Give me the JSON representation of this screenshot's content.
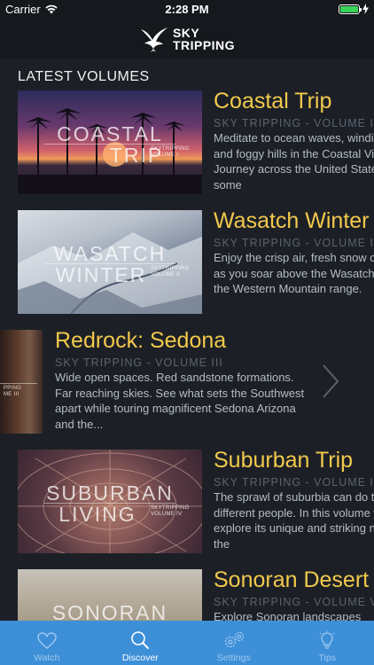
{
  "status_bar": {
    "carrier": "Carrier",
    "time": "2:28 PM",
    "battery_level": 1.0
  },
  "header": {
    "logo_line1": "SKY",
    "logo_line2": "TRIPPING"
  },
  "section_title": "LATEST VOLUMES",
  "volumes": [
    {
      "title": "Coastal Trip",
      "subtitle": "SKY TRIPPING - VOLUME I",
      "description": "Meditate to ocean waves, winding roads, and foggy hills in the Coastal Views pack. Journey across the United States to see some",
      "thumb_line1": "COASTAL",
      "thumb_line2": "TRIP",
      "thumb_sub1": "SKYTRIPPING",
      "thumb_sub2": "VOLUME I"
    },
    {
      "title": "Wasatch Winter",
      "subtitle": "SKY TRIPPING - VOLUME II",
      "description": "Enjoy the crisp air, fresh snow of winter as you soar above the Wasatch peaks of the Western Mountain range.",
      "thumb_line1": "WASATCH",
      "thumb_line2": "WINTER",
      "thumb_sub1": "SKYTRIPPING",
      "thumb_sub2": "VOLUME II"
    },
    {
      "title": "Redrock: Sedona",
      "subtitle": "SKY TRIPPING - VOLUME III",
      "description": "Wide open spaces. Red sandstone formations. Far reaching skies. See what sets the Southwest apart while touring magnificent Sedona Arizona and the...",
      "thumb_line1": "",
      "thumb_line2": "",
      "thumb_sub1": "PPING",
      "thumb_sub2": "ME III"
    },
    {
      "title": "Suburban Trip",
      "subtitle": "SKY TRIPPING - VOLUME IV",
      "description": "The sprawl of suburbia can do things to different people. In this volume we explore its unique and striking nature of the",
      "thumb_line1": "SUBURBAN",
      "thumb_line2": "LIVING",
      "thumb_sub1": "SKYTRIPPING",
      "thumb_sub2": "VOLUME IV"
    },
    {
      "title": "Sonoran Desert",
      "subtitle": "SKY TRIPPING - VOLUME V",
      "description": "Explore Sonoran landscapes",
      "thumb_line1": "SONORAN",
      "thumb_line2": "",
      "thumb_sub1": "",
      "thumb_sub2": ""
    }
  ],
  "tabs": [
    {
      "label": "Watch",
      "icon": "heart-icon"
    },
    {
      "label": "Discover",
      "icon": "search-icon"
    },
    {
      "label": "Settings",
      "icon": "gears-icon"
    },
    {
      "label": "Tips",
      "icon": "lightbulb-icon"
    }
  ],
  "colors": {
    "accent_title": "#f2c94c",
    "tab_bar": "#3d8fd8",
    "background": "#1c2026"
  }
}
